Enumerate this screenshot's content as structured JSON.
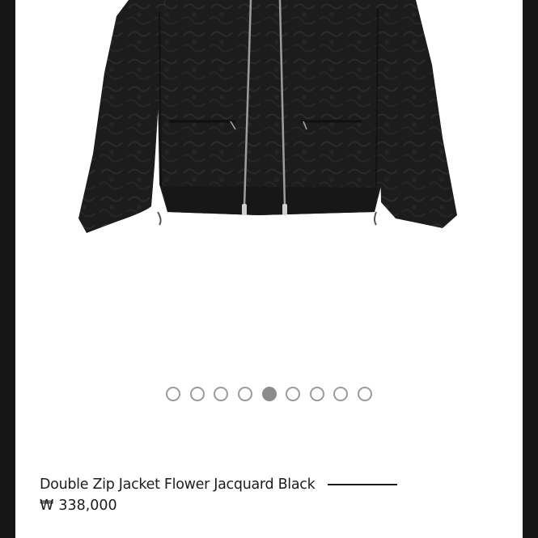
{
  "gallery": {
    "slide_count": 9,
    "active_slide": 5,
    "image_icon": "black-jacket-photo"
  },
  "product": {
    "title": "Double Zip Jacket Flower Jacquard Black",
    "currency_symbol": "₩",
    "price": "338,000"
  },
  "colors": {
    "frame": "#161616",
    "background": "#ffffff",
    "jacket": "#1b1b1b",
    "dot_active": "#8c8c8c",
    "dot_inactive_border": "#9a9a9a",
    "text": "#1c1c1c"
  }
}
